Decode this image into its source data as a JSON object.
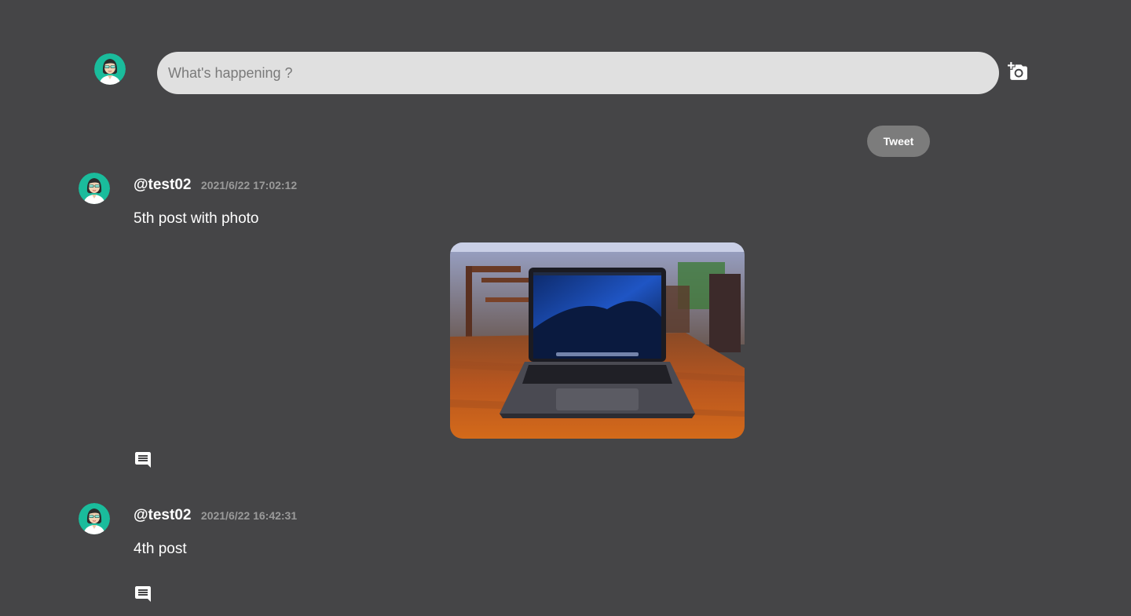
{
  "composer": {
    "placeholder": "What's happening ?",
    "value": "",
    "add_photo_icon": "add-a-photo-icon",
    "tweet_label": "Tweet"
  },
  "posts": [
    {
      "username": "@test02",
      "date": "2021/6/22 17:02:12",
      "text": "5th post with photo",
      "has_photo": true,
      "photo_subject": "laptop on a wooden cafe table",
      "comment_icon": "comment-icon"
    },
    {
      "username": "@test02",
      "date": "2021/6/22 16:42:31",
      "text": "4th post",
      "has_photo": false,
      "comment_icon": "comment-icon"
    }
  ],
  "colors": {
    "background": "#454547",
    "input_bg": "#e0e0e0",
    "tweet_button_bg": "#7c7c7c",
    "avatar_bg": "#1abc9c",
    "date_text": "#9a9a9a"
  }
}
